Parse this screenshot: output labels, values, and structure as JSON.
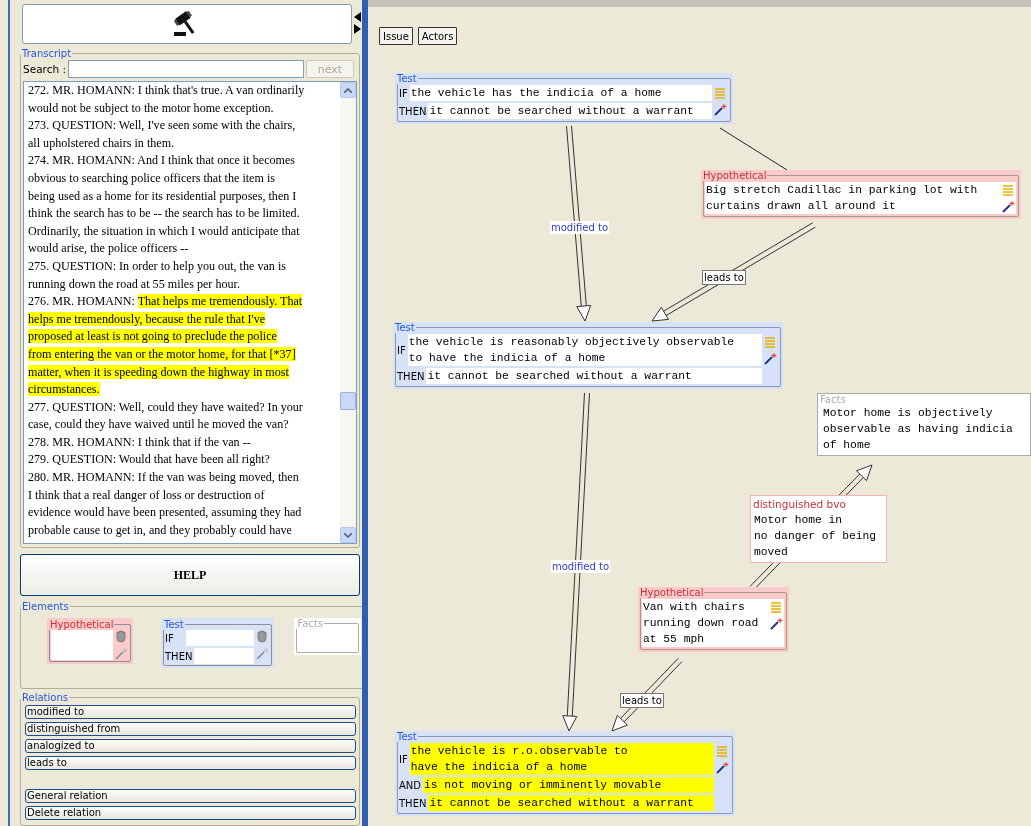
{
  "transcript": {
    "title": "Transcript",
    "search_label": "Search :",
    "next_button": {
      "label": "next",
      "disabled": true
    },
    "lines": [
      [
        {
          "text": "272. MR. HOMANN: I think that's true. A van ordinarily",
          "highlighted": false
        }
      ],
      [
        {
          "text": "would not be subject to the motor home exception.",
          "highlighted": false
        }
      ],
      [
        {
          "text": "273. QUESTION: Well, I've seen some with the chairs,",
          "highlighted": false
        }
      ],
      [
        {
          "text": "all upholstered chairs in them.",
          "highlighted": false
        }
      ],
      [
        {
          "text": "274. MR. HOMANN: And I think that once it becomes",
          "highlighted": false
        }
      ],
      [
        {
          "text": "obvious to searching police officers that the item is",
          "highlighted": false
        }
      ],
      [
        {
          "text": "being used as a home for its residential purposes, then I",
          "highlighted": false
        }
      ],
      [
        {
          "text": "think the search has to be -- the search has to be limited.",
          "highlighted": false
        }
      ],
      [
        {
          "text": "Ordinarily, the situation in which I would anticipate that",
          "highlighted": false
        }
      ],
      [
        {
          "text": "would arise, the police officers --",
          "highlighted": false
        }
      ],
      [
        {
          "text": "275. QUESTION: In order to help you out, the van is",
          "highlighted": false
        }
      ],
      [
        {
          "text": "running down the road at 55 miles per hour.",
          "highlighted": false
        }
      ],
      [
        {
          "text": "276. MR. HOMANN: ",
          "highlighted": false
        },
        {
          "text": "That helps me tremendously. That",
          "highlighted": true
        }
      ],
      [
        {
          "text": "helps me tremendously, because the rule that I've",
          "highlighted": true
        }
      ],
      [
        {
          "text": "proposed at least is not going to preclude the police",
          "highlighted": true
        }
      ],
      [
        {
          "text": "from entering the van or the motor home, for that [*37]",
          "highlighted": true
        }
      ],
      [
        {
          "text": "matter, when it is speeding down the highway in most",
          "highlighted": true
        }
      ],
      [
        {
          "text": "circumstances.",
          "highlighted": true
        }
      ],
      [
        {
          "text": "277. QUESTION: Well, could they have waited? In your",
          "highlighted": false
        }
      ],
      [
        {
          "text": "case, could they have waived until he moved the van?",
          "highlighted": false
        }
      ],
      [
        {
          "text": "278. MR. HOMANN: I think that if the van --",
          "highlighted": false
        }
      ],
      [
        {
          "text": "279. QUESTION: Would that have been all right?",
          "highlighted": false
        }
      ],
      [
        {
          "text": "280. MR. HOMANN: If the van was being moved, then",
          "highlighted": false
        }
      ],
      [
        {
          "text": "I think that a real danger of loss or destruction of",
          "highlighted": false
        }
      ],
      [
        {
          "text": "evidence would have been presented, assuming they had",
          "highlighted": false
        }
      ],
      [
        {
          "text": "probable cause to get in, and they probably could have",
          "highlighted": false
        }
      ]
    ]
  },
  "help_button": "HELP",
  "elements": {
    "title": "Elements",
    "templates": [
      {
        "kind": "hypothetical",
        "title": "Hypothetical",
        "disabled": false
      },
      {
        "kind": "test",
        "title": "Test",
        "row_labels": [
          "IF",
          "THEN"
        ],
        "disabled": false
      },
      {
        "kind": "facts",
        "title": "Facts",
        "disabled": true
      }
    ]
  },
  "relations": {
    "title": "Relations",
    "buttons": [
      {
        "label": "modified to",
        "kind": "relation"
      },
      {
        "label": "distinguished from",
        "kind": "relation"
      },
      {
        "label": "analogized to",
        "kind": "relation"
      },
      {
        "label": "leads to",
        "kind": "relation"
      },
      {
        "label": "General relation",
        "kind": "action"
      },
      {
        "label": "Delete relation",
        "kind": "action"
      }
    ]
  },
  "canvas": {
    "buttons": [
      "Issue",
      "Actors"
    ],
    "nodes": [
      {
        "kind": "test",
        "title": "Test",
        "rows": [
          {
            "label": "IF",
            "lines": [
              "the vehicle has the indicia of a home"
            ],
            "highlighted": false
          },
          {
            "label": "THEN",
            "lines": [
              "it cannot be searched without a warrant"
            ],
            "highlighted": false
          }
        ]
      },
      {
        "kind": "hypothetical",
        "title": "Hypothetical",
        "lines": [
          "Big stretch Cadillac in parking lot with",
          "curtains drawn all around it"
        ]
      },
      {
        "kind": "test",
        "title": "Test",
        "rows": [
          {
            "label": "IF",
            "lines": [
              "the vehicle is reasonably objectively observable",
              "to have the indicia of a home"
            ],
            "highlighted": false
          },
          {
            "label": "THEN",
            "lines": [
              "it cannot be searched without a warrant"
            ],
            "highlighted": false
          }
        ]
      },
      {
        "kind": "facts",
        "title": "Facts",
        "lines": [
          "Motor home is objectively",
          "observable as having indicia",
          "of home"
        ]
      },
      {
        "kind": "distinction",
        "title": "distinguished bvo",
        "lines": [
          "Motor home in",
          "no danger of being",
          "moved"
        ]
      },
      {
        "kind": "hypothetical",
        "title": "Hypothetical",
        "lines": [
          "Van with chairs",
          "running down road",
          "at 55 mph"
        ]
      },
      {
        "kind": "test",
        "title": "Test",
        "rows": [
          {
            "label": "IF",
            "lines": [
              "the vehicle is r.o.observable to",
              "have the indicia of a home"
            ],
            "highlighted": true
          },
          {
            "label": "AND",
            "lines": [
              "is not moving or imminently movable"
            ],
            "highlighted": true
          },
          {
            "label": "THEN",
            "lines": [
              "it cannot be searched without a warrant"
            ],
            "highlighted": true
          }
        ]
      }
    ],
    "edges": [
      {
        "kind": "modified",
        "label": "modified to"
      },
      {
        "kind": "leads",
        "label": "leads to"
      },
      {
        "kind": "modified",
        "label": "modified to"
      },
      {
        "kind": "leads",
        "label": "leads to"
      },
      {
        "kind": "distinguished"
      },
      {
        "kind": "plain"
      }
    ]
  }
}
